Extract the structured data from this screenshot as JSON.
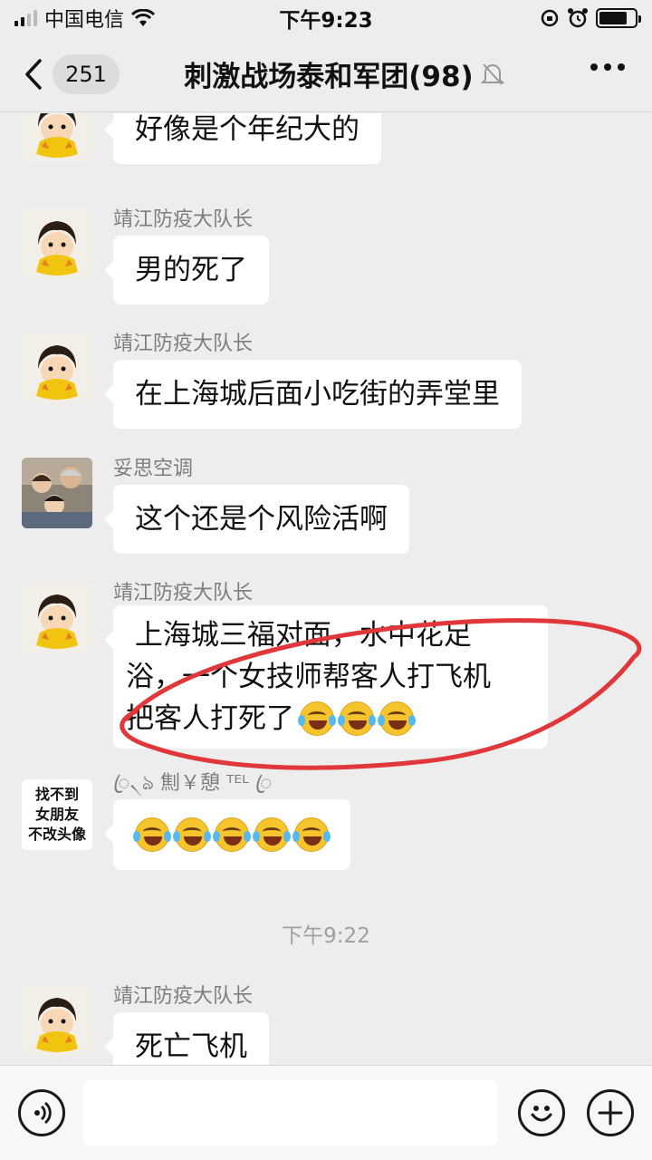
{
  "status_bar": {
    "carrier": "中国电信",
    "time": "下午9:23",
    "signal_bars": 4,
    "signal_active": 2,
    "battery_level": 0.8
  },
  "nav": {
    "back_icon": "chevron-left-icon",
    "unread_count": "251",
    "title": "刺激战场泰和军团(98)",
    "mute_icon": "bell-muted-icon",
    "more_icon": "more-dots-icon"
  },
  "messages": [
    {
      "sender": "",
      "text": "好像是个年纪大的",
      "avatar": "cartoon-boy"
    },
    {
      "sender": "靖江防疫大队长",
      "text": "男的死了",
      "avatar": "cartoon-boy"
    },
    {
      "sender": "靖江防疫大队长",
      "text": "在上海城后面小吃街的弄堂里",
      "avatar": "cartoon-boy"
    },
    {
      "sender": "妥思空调",
      "text": "这个还是个风险活啊",
      "avatar": "family-photo"
    },
    {
      "sender": "靖江防疫大队长",
      "lines": [
        " 上海城三福对面，水中花足",
        "浴，一个女技师帮客人打飞机",
        "把客人打死了"
      ],
      "emoji_count": 3,
      "avatar": "cartoon-boy"
    },
    {
      "sender": "ꦿ৲ঌ 劁￥憩 ᵀᴱᴸ ꦿ",
      "emoji_count": 5,
      "avatar_text": [
        "找不到",
        "女朋友",
        "不改头像"
      ]
    },
    {
      "sender": "靖江防疫大队长",
      "text": "死亡飞机",
      "avatar": "cartoon-boy"
    }
  ],
  "timestamp": "下午9:22",
  "input_bar": {
    "voice_icon": "voice-icon",
    "input_value": "",
    "emoji_icon": "smiley-icon",
    "plus_icon": "plus-icon"
  },
  "colors": {
    "background": "#ededed",
    "bubble": "#ffffff",
    "annotation": "#e0373a"
  }
}
